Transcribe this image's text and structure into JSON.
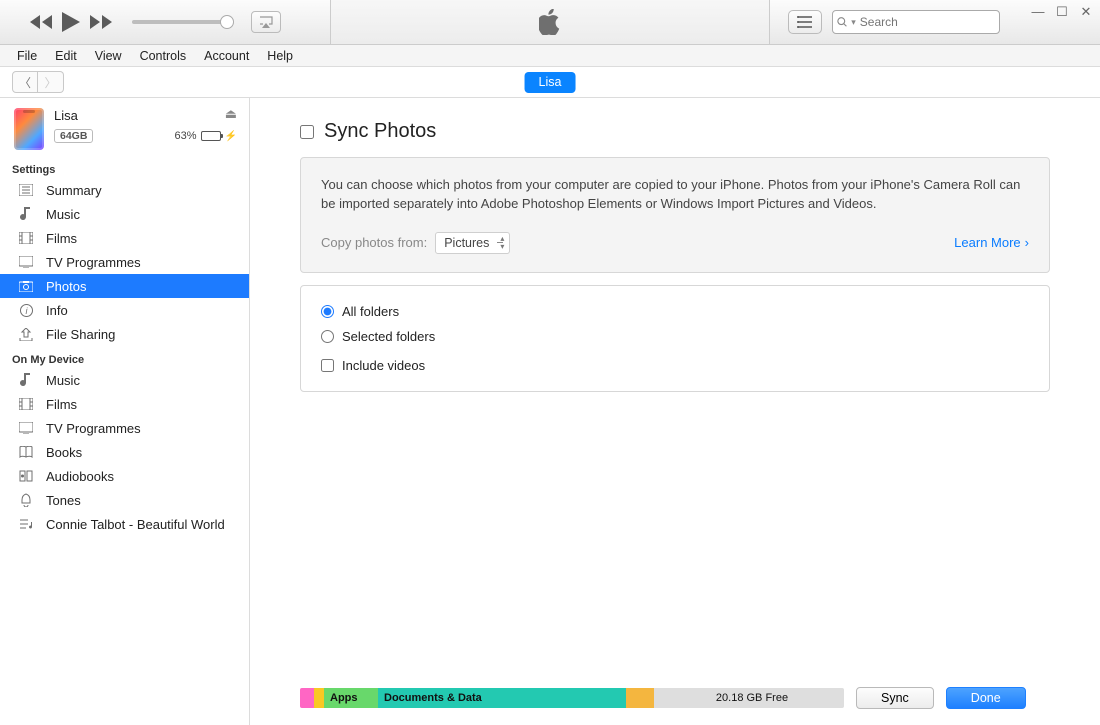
{
  "window_controls": {
    "min": "—",
    "max": "☐",
    "close": "✕"
  },
  "search": {
    "placeholder": "Search"
  },
  "menubar": [
    "File",
    "Edit",
    "View",
    "Controls",
    "Account",
    "Help"
  ],
  "crumb": "Lisa",
  "device": {
    "name": "Lisa",
    "capacity": "64GB",
    "battery_pct": "63%"
  },
  "sidebar": {
    "settings_label": "Settings",
    "settings_items": [
      {
        "icon": "summary",
        "label": "Summary"
      },
      {
        "icon": "music",
        "label": "Music"
      },
      {
        "icon": "film",
        "label": "Films"
      },
      {
        "icon": "tv",
        "label": "TV Programmes"
      },
      {
        "icon": "photo",
        "label": "Photos",
        "selected": true
      },
      {
        "icon": "info",
        "label": "Info"
      },
      {
        "icon": "share",
        "label": "File Sharing"
      }
    ],
    "device_label": "On My Device",
    "device_items": [
      {
        "icon": "music",
        "label": "Music"
      },
      {
        "icon": "film",
        "label": "Films"
      },
      {
        "icon": "tv",
        "label": "TV Programmes"
      },
      {
        "icon": "book",
        "label": "Books"
      },
      {
        "icon": "audiobook",
        "label": "Audiobooks"
      },
      {
        "icon": "tone",
        "label": "Tones"
      },
      {
        "icon": "playlist",
        "label": "Connie Talbot - Beautiful World"
      }
    ]
  },
  "main": {
    "title": "Sync Photos",
    "desc": "You can choose which photos from your computer are copied to your iPhone. Photos from your iPhone's Camera Roll can be imported separately into Adobe Photoshop Elements or Windows Import Pictures and Videos.",
    "copy_label": "Copy photos from:",
    "copy_source": "Pictures",
    "learn_more": "Learn More",
    "opt_all": "All folders",
    "opt_sel": "Selected folders",
    "opt_vid": "Include videos"
  },
  "footer": {
    "seg_apps": "Apps",
    "seg_docs": "Documents & Data",
    "seg_free": "20.18 GB Free",
    "sync": "Sync",
    "done": "Done"
  }
}
